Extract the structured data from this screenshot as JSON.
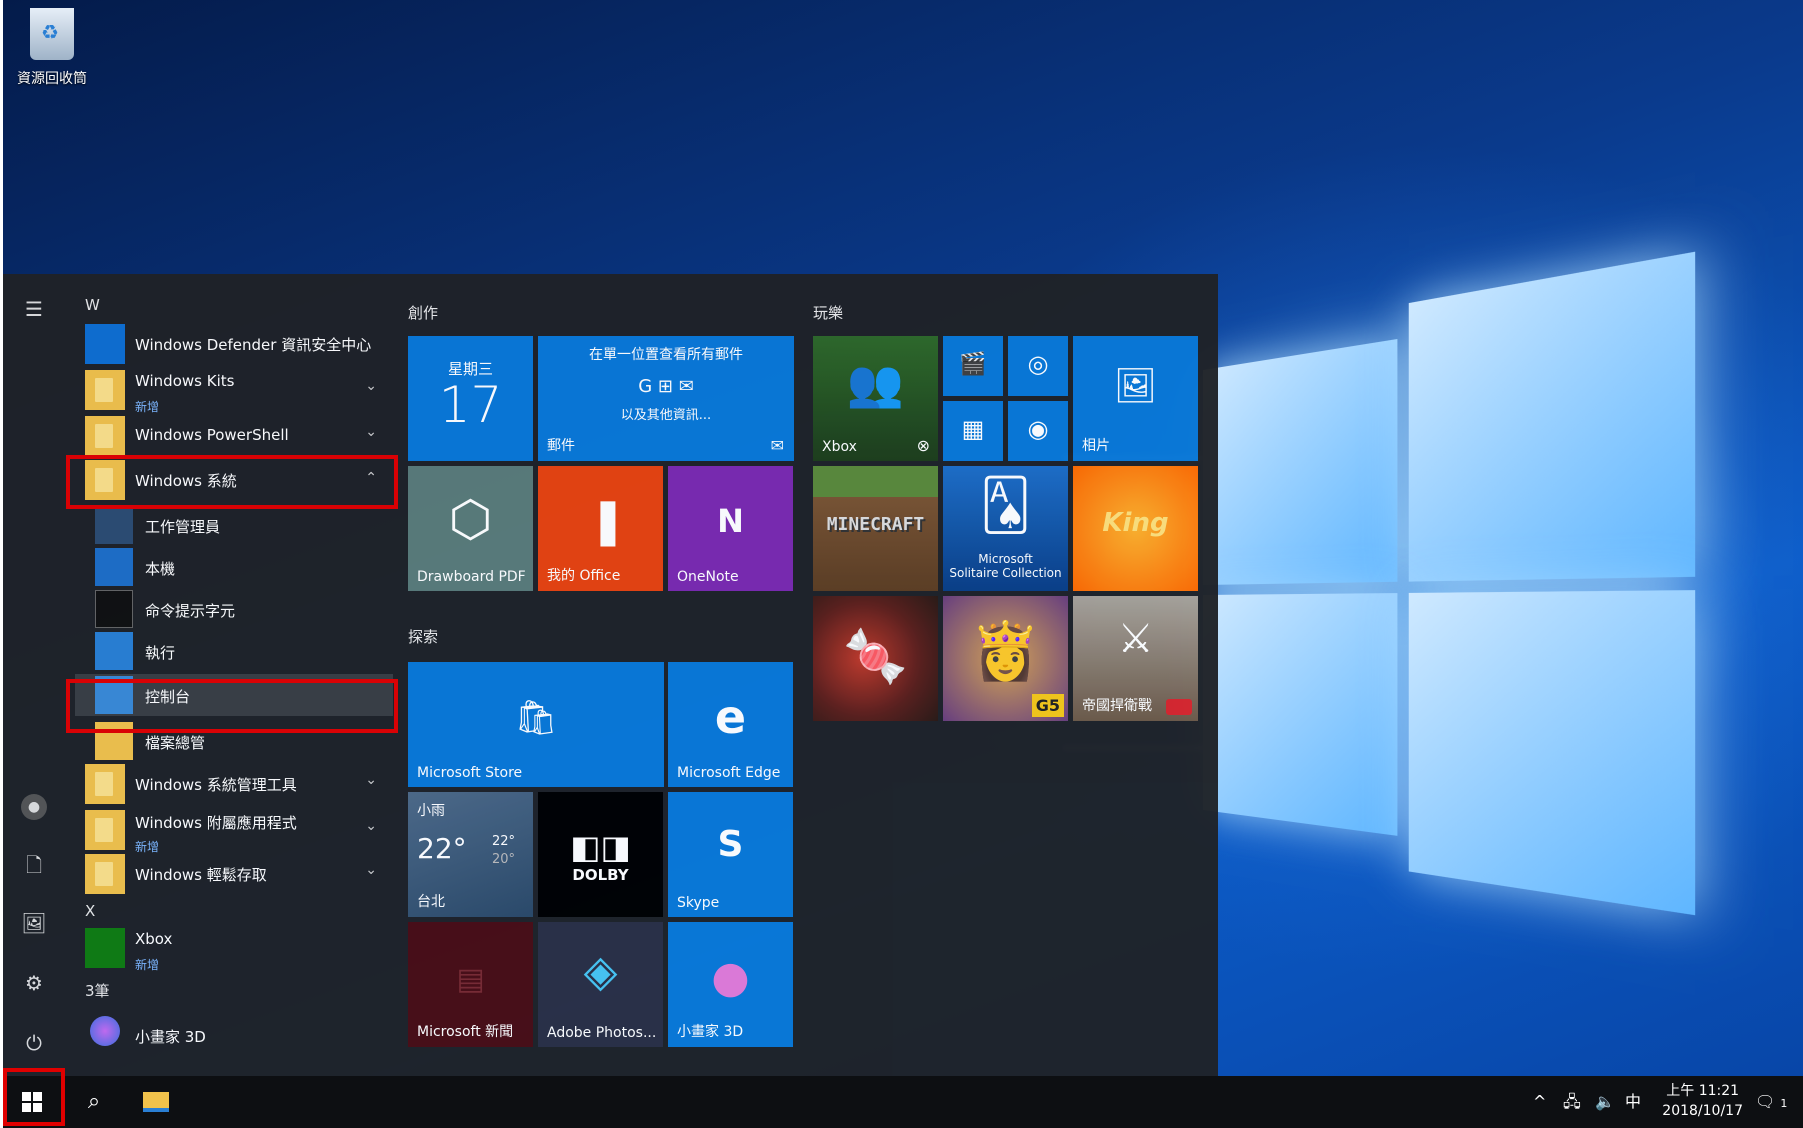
{
  "desktop": {
    "recycle_bin_label": "資源回收筒"
  },
  "start_menu": {
    "section_w": "W",
    "apps_w": [
      {
        "name": "Windows Defender 資訊安全中心",
        "sub": "",
        "icon": "shield-icon"
      },
      {
        "name": "Windows Kits",
        "sub": "新增",
        "icon": "folder-icon"
      },
      {
        "name": "Windows PowerShell",
        "sub": "",
        "icon": "folder-icon"
      },
      {
        "name": "Windows 系統",
        "sub": "",
        "icon": "folder-icon"
      }
    ],
    "windows_system_items": [
      "工作管理員",
      "本機",
      "命令提示字元",
      "執行",
      "控制台",
      "檔案總管"
    ],
    "apps_w2": [
      {
        "name": "Windows 系統管理工具",
        "sub": ""
      },
      {
        "name": "Windows 附屬應用程式",
        "sub": "新增"
      },
      {
        "name": "Windows 輕鬆存取",
        "sub": ""
      }
    ],
    "section_x": "X",
    "xbox": {
      "name": "Xbox",
      "sub": "新增"
    },
    "section_3": "3筆",
    "paint3d": "小畫家 3D"
  },
  "tiles": {
    "group_create": "創作",
    "group_explore": "探索",
    "group_play": "玩樂",
    "calendar": {
      "day": "星期三",
      "date": "17"
    },
    "mail": {
      "title": "在單一位置查看所有郵件",
      "more": "以及其他資訊...",
      "label": "郵件"
    },
    "drawboard": "Drawboard PDF",
    "office": "我的 Office",
    "onenote": "OneNote",
    "store": "Microsoft Store",
    "edge": "Microsoft Edge",
    "weather": {
      "cond": "小雨",
      "temp": "22°",
      "high": "22°",
      "low": "20°",
      "city": "台北"
    },
    "dolby": "DOLBY",
    "skype": "Skype",
    "news": "Microsoft 新聞",
    "photoshop": "Adobe Photos...",
    "paint3d": "小畫家 3D",
    "xbox": "Xbox",
    "photos": "相片",
    "minecraft": "MINECRAFT",
    "solitaire": "Microsoft\nSolitaire Collection",
    "king": "King",
    "empire": "帝國捍衛戰",
    "g5": "G5"
  },
  "taskbar": {
    "ime": "中",
    "time": "上午 11:21",
    "date": "2018/10/17",
    "notif_count": "1"
  },
  "colors": {
    "highlight": "#e00000",
    "tile_blue": "#0a78d7",
    "start_bg": "#1f2328"
  }
}
